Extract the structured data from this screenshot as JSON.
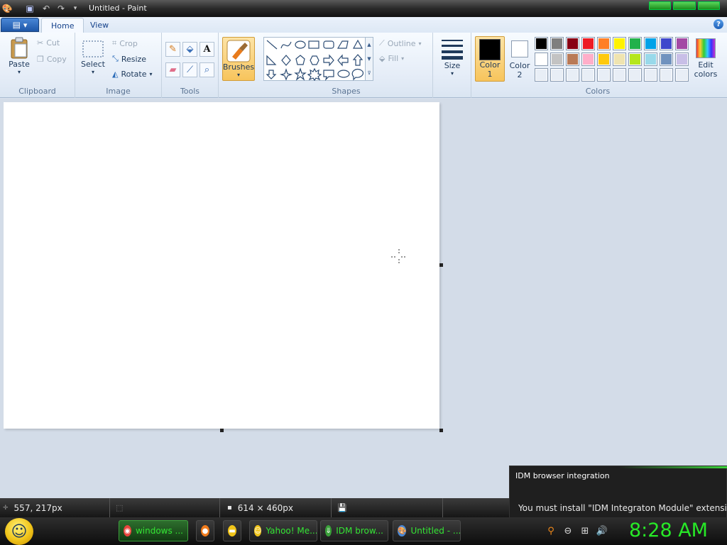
{
  "window": {
    "title": "Untitled - Paint"
  },
  "quick_access": {
    "icons": [
      "paint-app-icon",
      "save-icon",
      "undo-icon",
      "redo-icon",
      "customize-dropdown-icon"
    ]
  },
  "tabs": {
    "menu_label": "▾",
    "home": "Home",
    "view": "View",
    "help": "?"
  },
  "clipboard": {
    "paste": "Paste",
    "cut": "Cut",
    "copy": "Copy",
    "group": "Clipboard"
  },
  "image": {
    "select": "Select",
    "crop": "Crop",
    "resize": "Resize",
    "rotate": "Rotate",
    "group": "Image"
  },
  "tools": {
    "group": "Tools",
    "items": [
      "pencil",
      "fill",
      "text",
      "eraser",
      "color-picker",
      "magnifier"
    ]
  },
  "brushes": {
    "label": "Brushes"
  },
  "shapes": {
    "outline": "Outline",
    "fill": "Fill",
    "group": "Shapes"
  },
  "size": {
    "label": "Size"
  },
  "colors": {
    "color1_label": "Color 1",
    "color1_line1": "Color",
    "color1_line2": "1",
    "color2_line1": "Color",
    "color2_line2": "2",
    "edit_line1": "Edit",
    "edit_line2": "colors",
    "group": "Colors",
    "color1": "#000000",
    "color2": "#ffffff",
    "row1": [
      "#000000",
      "#7f7f7f",
      "#880015",
      "#ed1c24",
      "#ff7f27",
      "#fff200",
      "#22b14c",
      "#00a2e8",
      "#3f48cc",
      "#a349a4"
    ],
    "row2": [
      "#ffffff",
      "#c3c3c3",
      "#b97a57",
      "#ffaec9",
      "#ffc90e",
      "#efe4b0",
      "#b5e61d",
      "#99d9ea",
      "#7092be",
      "#c8bfe7"
    ],
    "row3": [
      "#e8eef6",
      "#e8eef6",
      "#e8eef6",
      "#e8eef6",
      "#e8eef6",
      "#e8eef6",
      "#e8eef6",
      "#e8eef6",
      "#e8eef6",
      "#e8eef6"
    ]
  },
  "status": {
    "cursor": "557, 217px",
    "selection": "",
    "canvas_size": "614 × 460px",
    "file_size": ""
  },
  "notification": {
    "title": "IDM browser integration",
    "text": "You must install \"IDM Integraton Module\" extension (ad"
  },
  "taskbar": {
    "items": [
      {
        "label": "windows ...",
        "icon": "chrome-icon",
        "color": "#e8453c",
        "active": true
      },
      {
        "label": "",
        "icon": "firefox-icon",
        "color": "#f07b1c",
        "active": false
      },
      {
        "label": "",
        "icon": "folder-icon",
        "color": "#f0c419",
        "active": false
      },
      {
        "label": "Yahoo! Me...",
        "icon": "yahoo-messenger-icon",
        "color": "#f0c419",
        "active": false
      },
      {
        "label": "IDM brow...",
        "icon": "idm-icon",
        "color": "#3aa03a",
        "active": false
      },
      {
        "label": "Untitled - ...",
        "icon": "paint-icon",
        "color": "#4a88d6",
        "active": false
      }
    ],
    "clock": "8:28 AM"
  }
}
